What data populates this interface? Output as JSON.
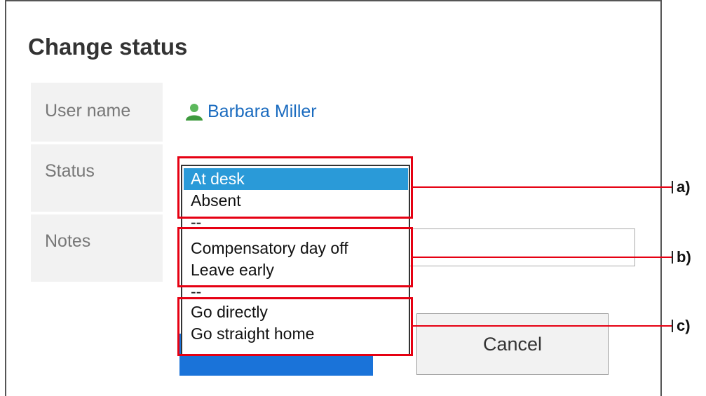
{
  "dialog": {
    "title": "Change status",
    "user_name_label": "User name",
    "user_name_value": "Barbara Miller",
    "status_label": "Status",
    "notes_label": "Notes",
    "cancel_label": "Cancel"
  },
  "status_dropdown": {
    "options": [
      {
        "label": "At desk",
        "selected": true
      },
      {
        "label": "Absent"
      },
      {
        "label": "--"
      },
      {
        "label": "Compensatory day off"
      },
      {
        "label": "Leave early"
      },
      {
        "label": "--"
      },
      {
        "label": "Go directly"
      },
      {
        "label": "Go straight home"
      }
    ]
  },
  "callouts": {
    "a": "a)",
    "b": "b)",
    "c": "c)"
  },
  "colors": {
    "highlight": "#e60012",
    "selected_option": "#2a9ad8",
    "link": "#1a6bbf",
    "primary_button": "#1a73d9"
  }
}
